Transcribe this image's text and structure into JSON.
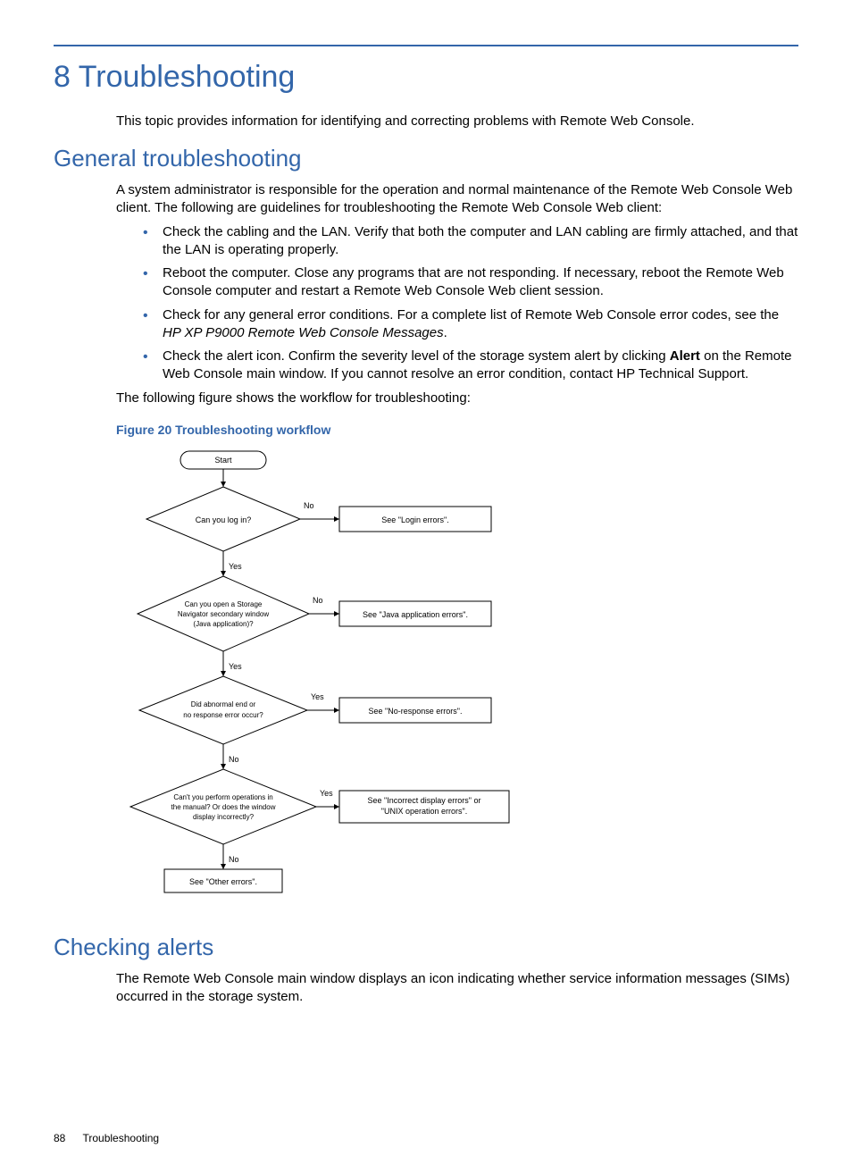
{
  "chapter": {
    "number": "8",
    "title": "Troubleshooting"
  },
  "intro": "This topic provides information for identifying and correcting problems with Remote Web Console.",
  "section1": {
    "title": "General troubleshooting",
    "p1": "A system administrator is responsible for the operation and normal maintenance of the Remote Web Console Web client. The following are guidelines for troubleshooting the Remote Web Console Web client:",
    "bullets": {
      "b1": "Check the cabling and the LAN. Verify that both the computer and LAN cabling are firmly attached, and that the LAN is operating properly.",
      "b2": "Reboot the computer. Close any programs that are not responding. If necessary, reboot the Remote Web Console computer and restart a Remote Web Console Web client session.",
      "b3a": "Check for any general error conditions. For a complete list of Remote Web Console error codes, see the ",
      "b3b": "HP XP P9000 Remote Web Console Messages",
      "b3c": ".",
      "b4a": "Check the alert icon. Confirm the severity level of the storage system alert by clicking ",
      "b4b": "Alert",
      "b4c": " on the Remote Web Console main window. If you cannot resolve an error condition, contact HP Technical Support."
    },
    "p2": "The following figure shows the workflow for troubleshooting:",
    "figcap": "Figure 20 Troubleshooting workflow"
  },
  "flow": {
    "start": "Start",
    "d1": "Can you log in?",
    "r1": "See \"Login errors\".",
    "d2a": "Can you open a Storage",
    "d2b": "Navigator secondary window",
    "d2c": "(Java application)?",
    "r2": "See \"Java application errors\".",
    "d3a": "Did abnormal end or",
    "d3b": "no response error occur?",
    "r3": "See \"No-response errors\".",
    "d4a": "Can't you perform operations in",
    "d4b": "the manual? Or does the window",
    "d4c": "display incorrectly?",
    "r4a": "See \"Incorrect display errors\" or",
    "r4b": "\"UNIX operation errors\".",
    "end": "See \"Other errors\".",
    "yes": "Yes",
    "no": "No"
  },
  "section2": {
    "title": "Checking alerts",
    "p1": "The Remote Web Console main window displays an icon indicating whether service information messages (SIMs) occurred in the storage system."
  },
  "footer": {
    "page": "88",
    "title": "Troubleshooting"
  }
}
